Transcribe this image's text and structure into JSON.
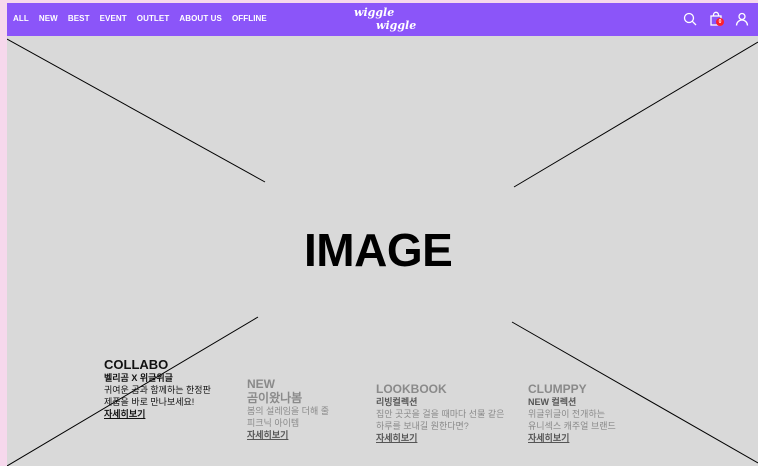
{
  "nav": {
    "menu": [
      "ALL",
      "NEW",
      "BEST",
      "EVENT",
      "OUTLET",
      "ABOUT US",
      "OFFLINE"
    ],
    "logo_line1": "wiggle",
    "logo_line2": "wiggle",
    "cart_count": "0",
    "icons": [
      "search-icon",
      "shopping-bag-icon",
      "user-icon"
    ]
  },
  "hero": {
    "label": "IMAGE"
  },
  "sections": [
    {
      "title": "COLLABO",
      "subtitle": "벨리곰 X 위글위글",
      "desc1": "귀여운 곰과 함께하는 한정판",
      "desc2": "제품을 바로 만나보세요!",
      "more": "자세히보기"
    },
    {
      "title": "NEW",
      "subtitle": "곰이왔나봄",
      "desc1": "봄의 설레임을 더해 줄",
      "desc2": "피크닉 아이템",
      "more": "자세히보기"
    },
    {
      "title": "LOOKBOOK",
      "subtitle": "리빙컬렉션",
      "desc1": "집안 곳곳을 걸을 때마다 선물 같은",
      "desc2": "하루를 보내길 원한다면?",
      "more": "자세히보기"
    },
    {
      "title": "CLUMPPY",
      "subtitle": "NEW 컬렉션",
      "desc1": "위글위글이 전개하는",
      "desc2": "유니섹스 캐주얼 브랜드",
      "more": "자세히보기"
    }
  ],
  "colors": {
    "nav_bg": "#8b55f9",
    "placeholder_bg": "#d9d9d9",
    "badge": "#ff1f2d"
  }
}
